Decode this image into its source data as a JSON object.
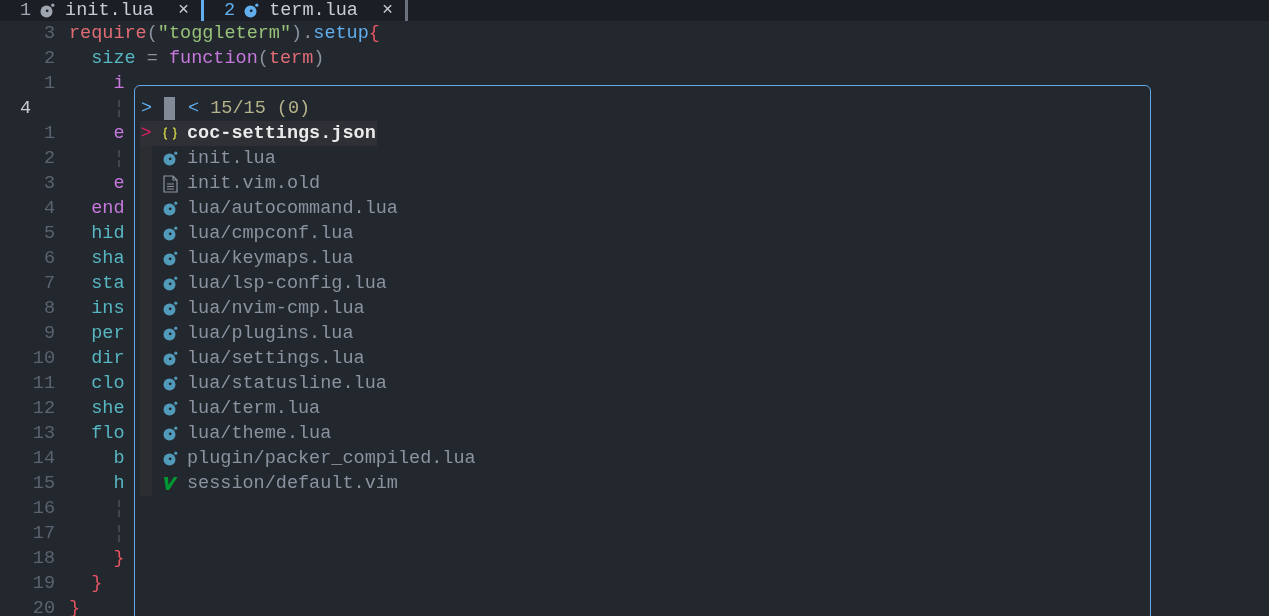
{
  "tabs": [
    {
      "number": "1",
      "title": "init.lua",
      "close": "×",
      "selected": false
    },
    {
      "number": "2",
      "title": "term.lua",
      "close": "×",
      "selected": true
    }
  ],
  "editor": {
    "lines": [
      {
        "number": "3",
        "current": false,
        "tokens": [
          {
            "text": "require",
            "kind": "builtin"
          },
          {
            "text": "(",
            "kind": "punct"
          },
          {
            "text": "\"toggleterm\"",
            "kind": "string"
          },
          {
            "text": ").",
            "kind": "punct"
          },
          {
            "text": "setup",
            "kind": "method"
          },
          {
            "text": "{",
            "kind": "bracket"
          }
        ]
      },
      {
        "number": "2",
        "current": false,
        "tokens": [
          {
            "text": "  size",
            "kind": "field"
          },
          {
            "text": " = ",
            "kind": "punct"
          },
          {
            "text": "function",
            "kind": "keyword"
          },
          {
            "text": "(",
            "kind": "punct"
          },
          {
            "text": "term",
            "kind": "builtin"
          },
          {
            "text": ")",
            "kind": "punct"
          }
        ]
      },
      {
        "number": "1",
        "current": false,
        "tokens": [
          {
            "text": "    i",
            "kind": "keyword"
          }
        ]
      },
      {
        "number": "4",
        "current": true,
        "tokens": [
          {
            "text": "    ¦",
            "kind": "guide"
          }
        ]
      },
      {
        "number": "1",
        "current": false,
        "tokens": [
          {
            "text": "    e",
            "kind": "keyword"
          }
        ]
      },
      {
        "number": "2",
        "current": false,
        "tokens": [
          {
            "text": "    ¦",
            "kind": "guide"
          }
        ]
      },
      {
        "number": "3",
        "current": false,
        "tokens": [
          {
            "text": "    e",
            "kind": "keyword"
          }
        ]
      },
      {
        "number": "4",
        "current": false,
        "tokens": [
          {
            "text": "  end",
            "kind": "keyword"
          }
        ]
      },
      {
        "number": "5",
        "current": false,
        "tokens": [
          {
            "text": "  hid",
            "kind": "field"
          }
        ]
      },
      {
        "number": "6",
        "current": false,
        "tokens": [
          {
            "text": "  sha",
            "kind": "field"
          }
        ]
      },
      {
        "number": "7",
        "current": false,
        "tokens": [
          {
            "text": "  sta",
            "kind": "field"
          }
        ]
      },
      {
        "number": "8",
        "current": false,
        "tokens": [
          {
            "text": "  ins",
            "kind": "field"
          }
        ]
      },
      {
        "number": "9",
        "current": false,
        "tokens": [
          {
            "text": "  per",
            "kind": "field"
          }
        ]
      },
      {
        "number": "10",
        "current": false,
        "tokens": [
          {
            "text": "  dir",
            "kind": "field"
          }
        ]
      },
      {
        "number": "11",
        "current": false,
        "tokens": [
          {
            "text": "  clo",
            "kind": "field"
          }
        ]
      },
      {
        "number": "12",
        "current": false,
        "tokens": [
          {
            "text": "  she",
            "kind": "field"
          }
        ]
      },
      {
        "number": "13",
        "current": false,
        "tokens": [
          {
            "text": "  flo",
            "kind": "field"
          }
        ]
      },
      {
        "number": "14",
        "current": false,
        "tokens": [
          {
            "text": "    b",
            "kind": "field"
          }
        ]
      },
      {
        "number": "15",
        "current": false,
        "tokens": [
          {
            "text": "    h",
            "kind": "field"
          }
        ]
      },
      {
        "number": "16",
        "current": false,
        "tokens": [
          {
            "text": "    ¦",
            "kind": "guide"
          }
        ]
      },
      {
        "number": "17",
        "current": false,
        "tokens": [
          {
            "text": "    ¦",
            "kind": "guide"
          }
        ]
      },
      {
        "number": "18",
        "current": false,
        "tokens": [
          {
            "text": "    }",
            "kind": "bracket"
          }
        ]
      },
      {
        "number": "19",
        "current": false,
        "tokens": [
          {
            "text": "  }",
            "kind": "bracket"
          }
        ]
      },
      {
        "number": "20",
        "current": false,
        "tokens": [
          {
            "text": "}",
            "kind": "bracket"
          }
        ]
      }
    ]
  },
  "finder": {
    "prompt_symbol": ">",
    "counter_marker": "<",
    "counter": "15/15 (0)",
    "selection_marker": ">",
    "items": [
      {
        "kind": "json",
        "name": "coc-settings.json",
        "selected": true
      },
      {
        "kind": "lua",
        "name": "init.lua",
        "selected": false
      },
      {
        "kind": "text",
        "name": "init.vim.old",
        "selected": false
      },
      {
        "kind": "lua",
        "name": "lua/autocommand.lua",
        "selected": false
      },
      {
        "kind": "lua",
        "name": "lua/cmpconf.lua",
        "selected": false
      },
      {
        "kind": "lua",
        "name": "lua/keymaps.lua",
        "selected": false
      },
      {
        "kind": "lua",
        "name": "lua/lsp-config.lua",
        "selected": false
      },
      {
        "kind": "lua",
        "name": "lua/nvim-cmp.lua",
        "selected": false
      },
      {
        "kind": "lua",
        "name": "lua/plugins.lua",
        "selected": false
      },
      {
        "kind": "lua",
        "name": "lua/settings.lua",
        "selected": false
      },
      {
        "kind": "lua",
        "name": "lua/statusline.lua",
        "selected": false
      },
      {
        "kind": "lua",
        "name": "lua/term.lua",
        "selected": false
      },
      {
        "kind": "lua",
        "name": "lua/theme.lua",
        "selected": false
      },
      {
        "kind": "lua",
        "name": "plugin/packer_compiled.lua",
        "selected": false
      },
      {
        "kind": "vim",
        "name": "session/default.vim",
        "selected": false
      }
    ]
  }
}
